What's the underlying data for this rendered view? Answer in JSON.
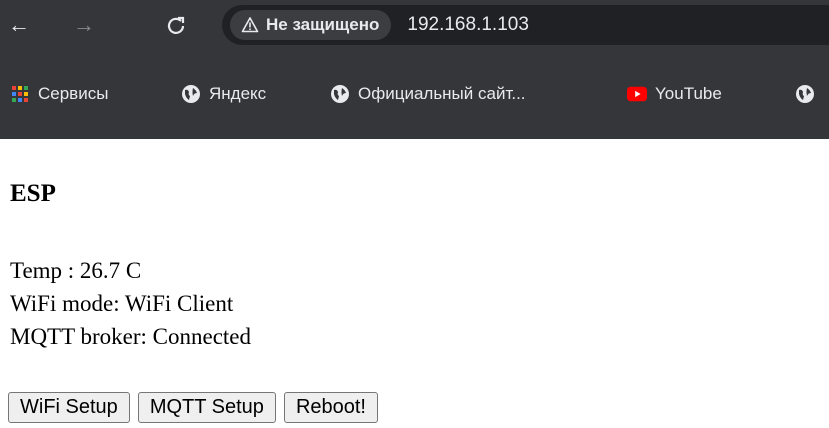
{
  "browser": {
    "nav": {
      "back_glyph": "←",
      "forward_glyph": "→",
      "reload_glyph": "C"
    },
    "omnibox": {
      "security_label": "Не защищено",
      "url": "192.168.1.103"
    },
    "bookmarks": [
      {
        "label": "Сервисы",
        "icon": "apps-grid-icon"
      },
      {
        "label": "Яндекс",
        "icon": "globe-icon"
      },
      {
        "label": "Официальный сайт...",
        "icon": "globe-icon"
      },
      {
        "label": "YouTube",
        "icon": "youtube-icon"
      },
      {
        "label": "",
        "icon": "globe-icon"
      }
    ]
  },
  "page": {
    "title": "ESP",
    "temp": "Temp : 26.7 C",
    "wifi_mode": "WiFi mode: WiFi Client",
    "mqtt_status": "MQTT broker: Connected",
    "buttons": {
      "wifi_setup": "WiFi Setup",
      "mqtt_setup": "MQTT Setup",
      "reboot": "Reboot!"
    }
  },
  "colors": {
    "chrome_bg": "#35363a",
    "omnibox_bg": "#202124",
    "youtube_red": "#ff0000"
  }
}
